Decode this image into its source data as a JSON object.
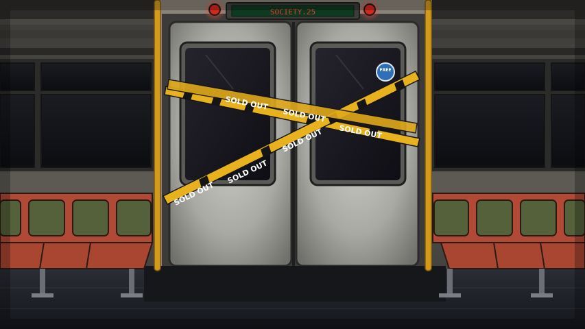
{
  "sign": {
    "text": "SOCIETY.25"
  },
  "sticker": {
    "text": "FREE"
  },
  "tape": {
    "label": "SOLD OUT"
  },
  "colors": {
    "sign_text": "#e23b2e",
    "tape_yellow": "#e8b21e",
    "tape_black": "#151515",
    "seat_frame": "#b04a36",
    "seat_cushion": "#55613a",
    "pole": "#d39a1c",
    "door_metal": "#b9b9b3"
  },
  "icons": [
    "alarm-light-icon",
    "free-sticker-icon"
  ]
}
